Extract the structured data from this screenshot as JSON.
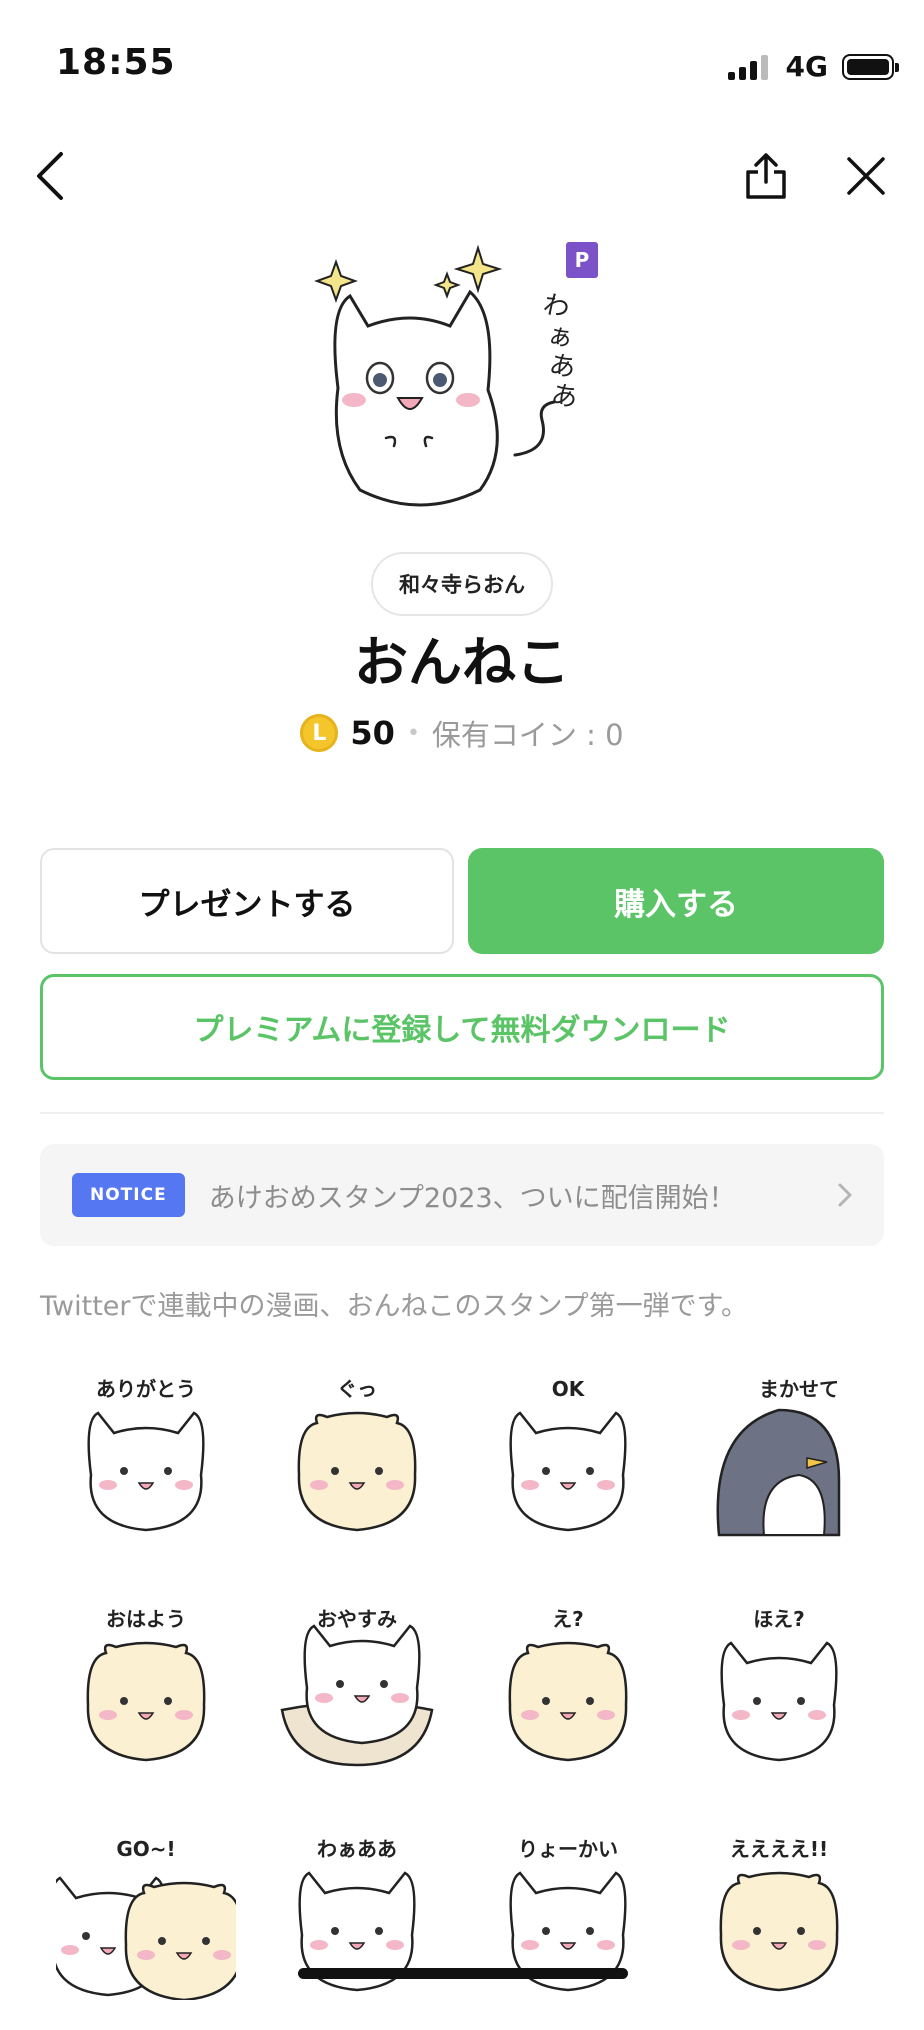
{
  "status_bar": {
    "time": "18:55",
    "network": "4G"
  },
  "nav": {
    "back_icon": "chevron-left-icon",
    "share_icon": "share-icon",
    "close_icon": "close-icon"
  },
  "product": {
    "premium_badge": "P",
    "author": "和々寺らおん",
    "title": "おんねこ",
    "coin_symbol": "L",
    "price": "50",
    "separator": "•",
    "owned_coins": "保有コイン : 0"
  },
  "buttons": {
    "present": "プレゼントする",
    "buy": "購入する",
    "premium": "プレミアムに登録して無料ダウンロード"
  },
  "notice": {
    "badge": "NOTICE",
    "text": "あけおめスタンプ2023、ついに配信開始！"
  },
  "description": "Twitterで連載中の漫画、おんねこのスタンプ第一弾です。",
  "stickers": [
    {
      "label": "ありがとう",
      "character": "cat"
    },
    {
      "label": "ぐっ",
      "character": "hamster"
    },
    {
      "label": "OK",
      "character": "cat"
    },
    {
      "label": "まかせて",
      "character": "penguin"
    },
    {
      "label": "おはよう",
      "character": "hamster"
    },
    {
      "label": "おやすみ",
      "character": "cat-basket"
    },
    {
      "label": "え?",
      "character": "hamster"
    },
    {
      "label": "ほえ?",
      "character": "cat"
    },
    {
      "label": "GO~!",
      "character": "cat-hamster"
    },
    {
      "label": "わぁああ",
      "character": "cat"
    },
    {
      "label": "りょーかい",
      "character": "cat"
    },
    {
      "label": "ええええ!!",
      "character": "hamster"
    }
  ],
  "colors": {
    "accent_green": "#5ac466",
    "notice_blue": "#5677f2",
    "premium_purple": "#7b52c7",
    "coin_gold": "#f4c62c"
  }
}
